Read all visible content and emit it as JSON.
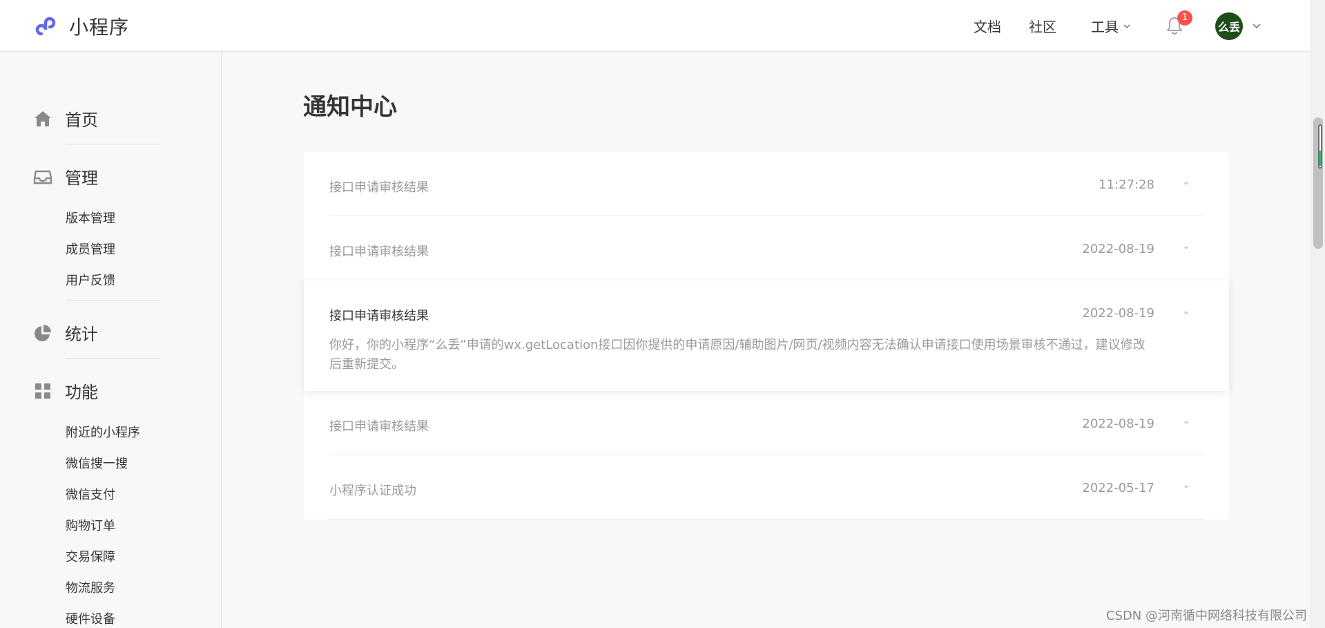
{
  "header": {
    "app_name": "小程序",
    "nav": [
      {
        "label": "文档"
      },
      {
        "label": "社区"
      },
      {
        "label": "工具"
      }
    ],
    "notification_count": "1",
    "avatar_text": "么丢"
  },
  "sidebar": {
    "groups": [
      {
        "label": "首页",
        "icon": "home-icon"
      },
      {
        "label": "管理",
        "icon": "inbox-icon",
        "items": [
          "版本管理",
          "成员管理",
          "用户反馈"
        ]
      },
      {
        "label": "统计",
        "icon": "pie-chart-icon"
      },
      {
        "label": "功能",
        "icon": "grid-icon",
        "items": [
          "附近的小程序",
          "微信搜一搜",
          "微信支付",
          "购物订单",
          "交易保障",
          "物流服务",
          "硬件设备"
        ]
      }
    ]
  },
  "main": {
    "title": "通知中心",
    "notices": [
      {
        "title": "接口申请审核结果",
        "time": "11:27:28"
      },
      {
        "title": "接口申请审核结果",
        "time": "2022-08-19"
      },
      {
        "title": "接口申请审核结果",
        "time": "2022-08-19",
        "body": "你好，你的小程序“么丢”申请的wx.getLocation接口因你提供的申请原因/辅助图片/网页/视频内容无法确认申请接口使用场景审核不通过，建议修改后重新提交。"
      },
      {
        "title": "接口申请审核结果",
        "time": "2022-08-19"
      },
      {
        "title": "小程序认证成功",
        "time": "2022-05-17"
      }
    ]
  },
  "watermark": "CSDN @河南循中网络科技有限公司",
  "colors": {
    "accent": "#6467f0",
    "badge": "#fa5151",
    "avatar_bg": "#1f4d1a"
  }
}
